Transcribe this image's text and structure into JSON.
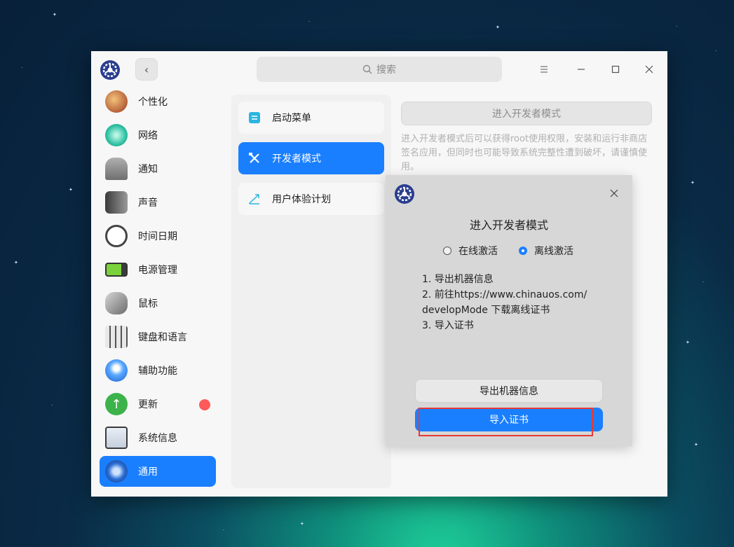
{
  "titlebar": {
    "search_placeholder": "搜索"
  },
  "sidebar": {
    "items": [
      {
        "label": "个性化"
      },
      {
        "label": "网络"
      },
      {
        "label": "通知"
      },
      {
        "label": "声音"
      },
      {
        "label": "时间日期"
      },
      {
        "label": "电源管理"
      },
      {
        "label": "鼠标"
      },
      {
        "label": "键盘和语言"
      },
      {
        "label": "辅助功能"
      },
      {
        "label": "更新"
      },
      {
        "label": "系统信息"
      },
      {
        "label": "通用"
      }
    ]
  },
  "middle": {
    "items": [
      {
        "label": "启动菜单"
      },
      {
        "label": "开发者模式"
      },
      {
        "label": "用户体验计划"
      }
    ]
  },
  "right": {
    "dev_button": "进入开发者模式",
    "description": "进入开发者模式后可以获得root使用权限，安装和运行非商店签名应用，但同时也可能导致系统完整性遭到破坏，请谨慎使用。"
  },
  "dialog": {
    "title": "进入开发者模式",
    "online_label": "在线激活",
    "offline_label": "离线激活",
    "step1": "1. 导出机器信息",
    "step2a": "2. 前往https://www.chinauos.com/",
    "step2b": "developMode 下载离线证书",
    "step3": "3. 导入证书",
    "export_button": "导出机器信息",
    "import_button": "导入证书"
  },
  "colors": {
    "accent": "#1a7fff",
    "badge": "#ff5a5a",
    "highlight": "#e53935"
  }
}
